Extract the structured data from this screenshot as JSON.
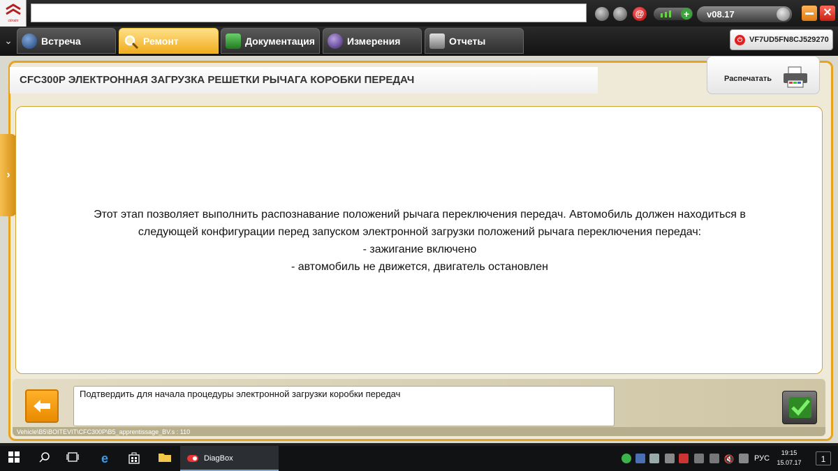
{
  "logo": {
    "brand_text": "citroën"
  },
  "toolbar": {
    "version": "v08.17",
    "mail_symbol": "@",
    "close_symbol": "✕"
  },
  "tabs": [
    {
      "label": "Встреча"
    },
    {
      "label": "Ремонт",
      "active": true
    },
    {
      "label": "Документация"
    },
    {
      "label": "Измерения"
    },
    {
      "label": "Отчеты"
    }
  ],
  "vehicle": {
    "vin": "VF7UD5FN8CJ529270"
  },
  "page": {
    "title": "CFC300P  ЭЛЕКТРОННАЯ ЗАГРУЗКА РЕШЕТКИ РЫЧАГА КОРОБКИ ПЕРЕДАЧ",
    "print_label": "Распечатать",
    "body_lines": [
      "Этот этап позволяет выполнить распознавание положений рычага переключения передач. Автомобиль должен находиться в",
      "следующей конфигурации перед запуском электронной загрузки положений рычага переключения передач:",
      "- зажигание включено",
      "- автомобиль не движется, двигатель остановлен"
    ],
    "message": "Подтвердить для начала процедуры электронной загрузки коробки передач",
    "path": "Vehicle\\B5\\BOITEVIT\\CFC300P\\B5_apprentissage_BV.s : 110"
  },
  "taskbar": {
    "app_label": "DiagBox",
    "language": "РУС",
    "time": "19:15",
    "date": "15.07.17",
    "notification_count": "1"
  },
  "colors": {
    "accent": "#f0ad1e",
    "frame_border": "#e8a21e",
    "confirm_check": "#4cd03a"
  }
}
